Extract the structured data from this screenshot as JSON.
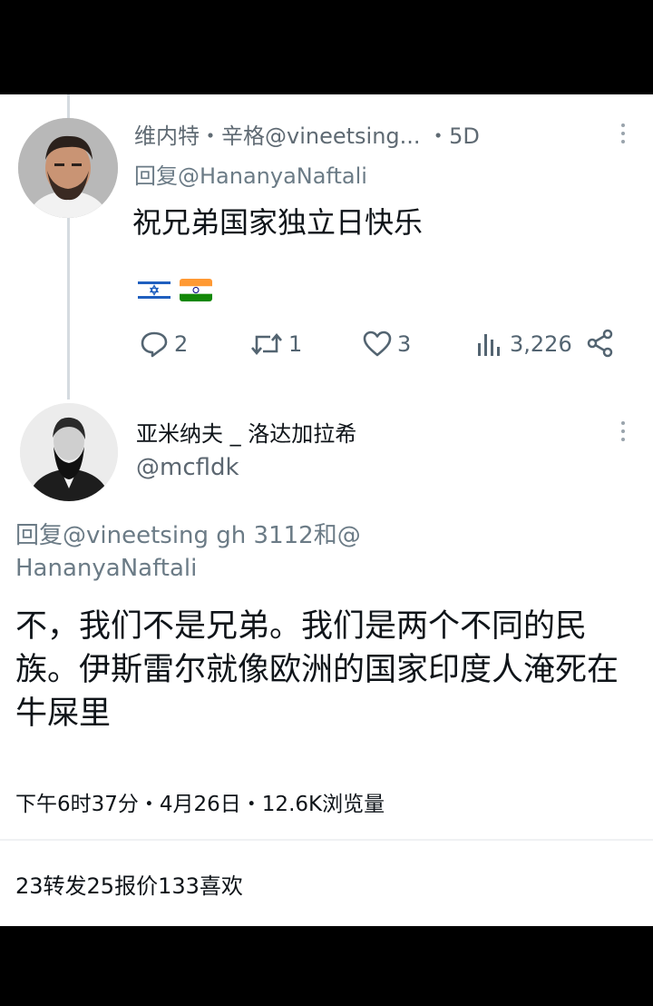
{
  "tweet1": {
    "author_line": "维内特・辛格@vineetsing... ・5D",
    "reply_to": "回复@HananyaNaftali",
    "text": "祝兄弟国家独立日快乐",
    "flags": [
      "israel-flag-icon",
      "india-flag-icon"
    ],
    "actions": {
      "replies": "2",
      "retweets": "1",
      "likes": "3",
      "views": "3,226"
    }
  },
  "tweet2": {
    "name": "亚米纳夫 _ 洛达加拉希",
    "handle": "@mcfldk",
    "reply_to": "回复@vineetsing gh 3112和@ HananyaNaftali",
    "text": "不，我们不是兄弟。我们是两个不同的民族。伊斯雷尔就像欧洲的国家印度人淹死在牛屎里",
    "meta": "下午6时37分・4月26日・12.6K浏览量",
    "stats": "23转发25报价133喜欢"
  },
  "colors": {
    "text_primary": "#0f1419",
    "text_secondary": "#536471",
    "background": "#ffffff",
    "frame": "#000000"
  }
}
